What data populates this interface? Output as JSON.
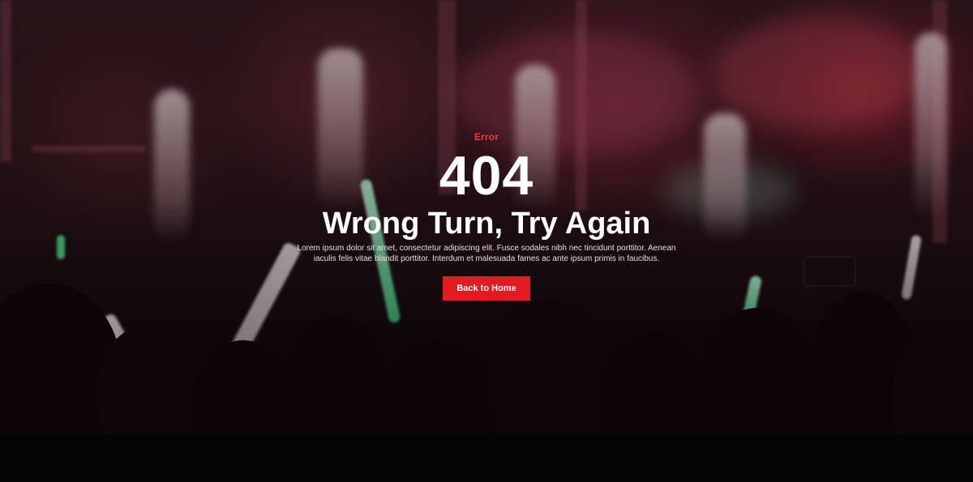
{
  "error_page": {
    "eyebrow": "Error",
    "code": "404",
    "headline": "Wrong Turn, Try Again",
    "description": "Lorem ipsum dolor sit amet, consectetur adipiscing elit. Fusce sodales nibh nec tincidunt porttitor. Aenean iaculis felis vitae blandit porttitor. Interdum et malesuada fames ac ante ipsum primis in faucibus.",
    "button_label": "Back to Home"
  },
  "colors": {
    "accent": "#e31b23",
    "eyebrow": "#ed3a3a",
    "text": "#ffffff",
    "footer": "#050505"
  }
}
